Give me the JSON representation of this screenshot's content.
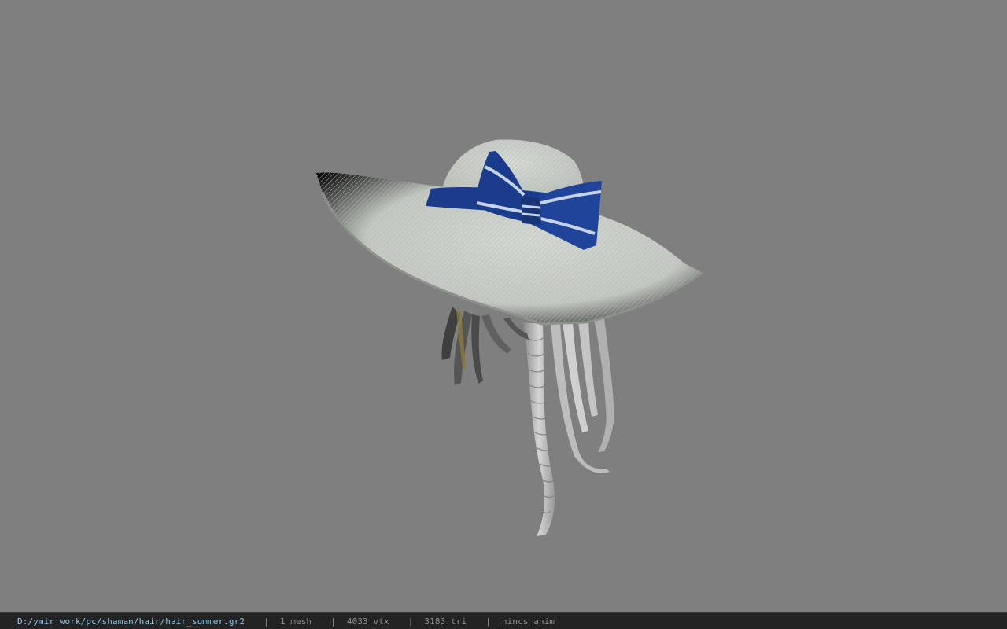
{
  "viewport": {
    "background": "#7f7f7f",
    "model": {
      "kind": "3d-model-preview",
      "subject": "wide-brim sun hat with blue striped bow over braided grey hair",
      "hat_color": "#c9cdc8",
      "ribbon_color": "#1b3c8c",
      "stripe_color": "#c7d3e6",
      "hair_color": "#c8c8c8"
    }
  },
  "status_bar": {
    "file_path": "D:/ymir work/pc/shaman/hair/hair_summer.gr2",
    "separator": "|",
    "mesh_count": "1 mesh",
    "vertex_count": "4033 vtx",
    "triangle_count": "3183 tri",
    "anim_status": "nincs anim",
    "path_color": "#8fc7e8",
    "background": "#232323"
  }
}
